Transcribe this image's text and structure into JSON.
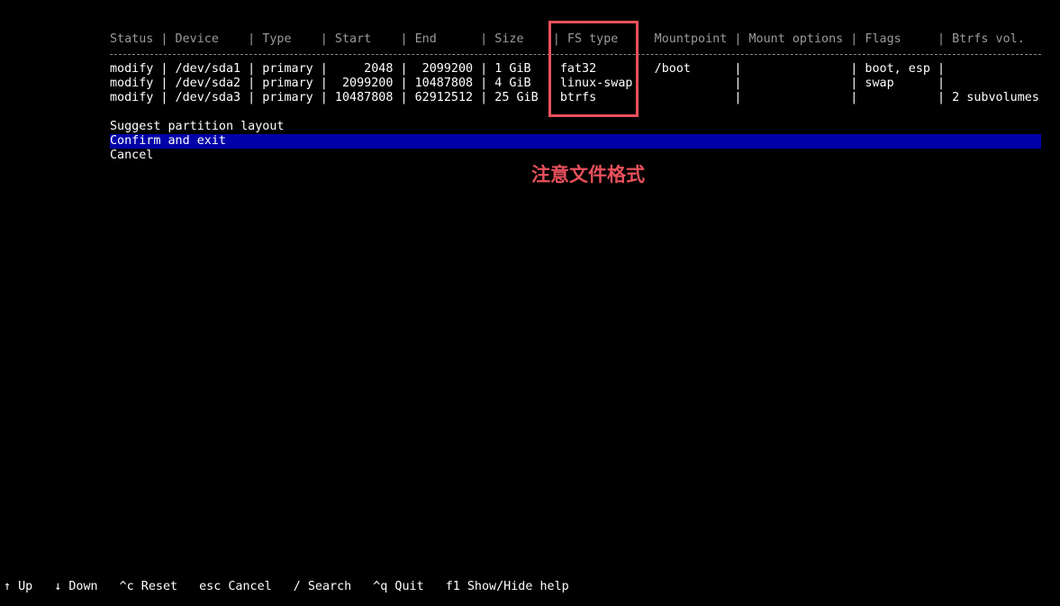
{
  "table": {
    "header": "Status | Device    | Type    | Start    | End      | Size    | FS type     Mountpoint | Mount options | Flags     | Btrfs vol.",
    "rows": [
      "modify | /dev/sda1 | primary |     2048 |  2099200 | 1 GiB  | fat32        /boot      |               | boot, esp |",
      "modify | /dev/sda2 | primary |  2099200 | 10487808 | 4 GiB  | linux-swap              |               | swap      |",
      "modify | /dev/sda3 | primary | 10487808 | 62912512 | 25 GiB | btrfs                   |               |           | 2 subvolumes"
    ]
  },
  "menu": {
    "items": [
      {
        "label": "Suggest partition layout"
      },
      {
        "label": "Confirm and exit"
      },
      {
        "label": "Cancel"
      }
    ]
  },
  "annotation": {
    "text": "注意文件格式",
    "color": "#e8505b"
  },
  "footer": {
    "items": [
      "↑ Up",
      "↓ Down",
      "^c Reset",
      "esc Cancel",
      "/ Search",
      "^q Quit",
      "f1 Show/Hide help"
    ]
  },
  "colors": {
    "background": "#000000",
    "selection": "#0000a8",
    "header_text": "#9a9a9a"
  }
}
